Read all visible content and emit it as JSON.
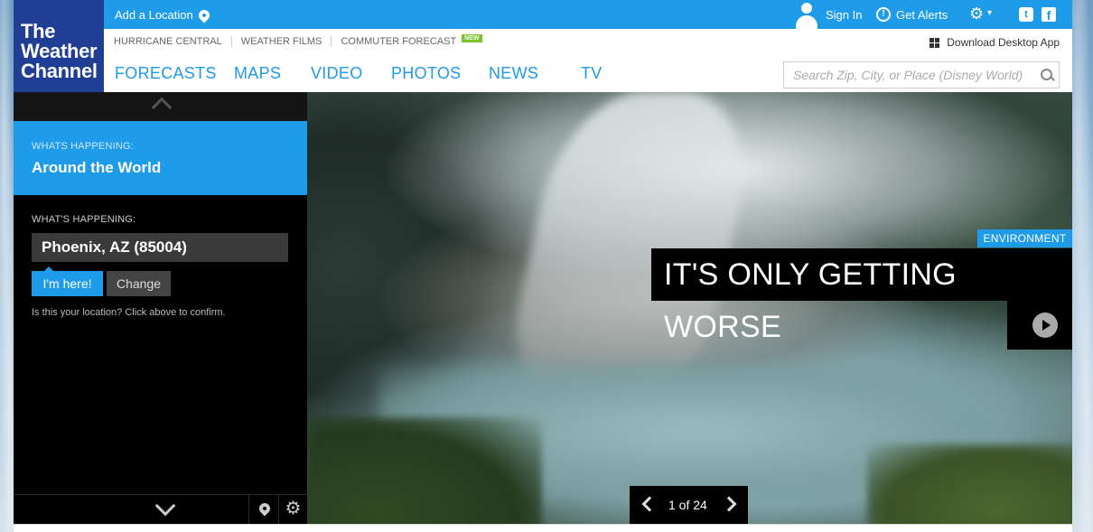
{
  "brand": {
    "logo_lines": [
      "The",
      "Weather",
      "Channel"
    ]
  },
  "topbar": {
    "add_location": "Add a Location",
    "sign_in": "Sign In",
    "get_alerts": "Get Alerts",
    "icons": [
      "location-pin-icon",
      "user-icon",
      "alert-icon",
      "gear-icon",
      "twitter-icon",
      "facebook-icon"
    ]
  },
  "sublinks": {
    "items": [
      "HURRICANE CENTRAL",
      "WEATHER FILMS",
      "COMMUTER FORECAST"
    ],
    "new_badge": "NEW",
    "download": "Download Desktop App"
  },
  "nav": {
    "items": [
      "FORECASTS",
      "MAPS",
      "VIDEO",
      "PHOTOS",
      "NEWS",
      "TV"
    ],
    "search_placeholder": "Search Zip, City, or Place (Disney World)"
  },
  "left_panel": {
    "world_label": "WHATS HAPPENING:",
    "world_title": "Around the World",
    "local_label": "WHAT'S HAPPENING:",
    "location": "Phoenix, AZ (85004)",
    "im_here": "I'm here!",
    "change": "Change",
    "confirm": "Is this your location? Click above to confirm."
  },
  "hero": {
    "category": "ENVIRONMENT",
    "headline": "IT'S ONLY GETTING WORSE",
    "pager": "1 of 24"
  },
  "colors": {
    "accent": "#1e9be9",
    "logo_bg": "#1f3e94",
    "panel_bg": "#000000"
  }
}
